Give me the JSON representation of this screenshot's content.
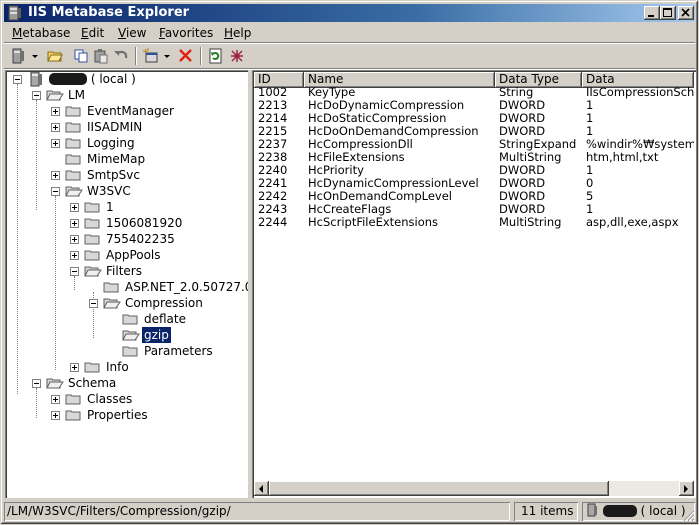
{
  "window": {
    "title": "IIS Metabase Explorer"
  },
  "menu": [
    {
      "label": "Metabase"
    },
    {
      "label": "Edit"
    },
    {
      "label": "View"
    },
    {
      "label": "Favorites"
    },
    {
      "label": "Help"
    }
  ],
  "tree": {
    "root_label": "( local )",
    "nodes": [
      {
        "label": "LM"
      },
      {
        "label": "EventManager"
      },
      {
        "label": "IISADMIN"
      },
      {
        "label": "Logging"
      },
      {
        "label": "MimeMap"
      },
      {
        "label": "SmtpSvc"
      },
      {
        "label": "W3SVC"
      },
      {
        "label": "1"
      },
      {
        "label": "1506081920"
      },
      {
        "label": "755402235"
      },
      {
        "label": "AppPools"
      },
      {
        "label": "Filters"
      },
      {
        "label": "ASP.NET_2.0.50727.0"
      },
      {
        "label": "Compression"
      },
      {
        "label": "deflate"
      },
      {
        "label": "gzip"
      },
      {
        "label": "Parameters"
      },
      {
        "label": "Info"
      },
      {
        "label": "Schema"
      },
      {
        "label": "Classes"
      },
      {
        "label": "Properties"
      }
    ]
  },
  "list": {
    "columns": [
      "ID",
      "Name",
      "Data Type",
      "Data"
    ],
    "rows": [
      {
        "id": "1002",
        "name": "KeyType",
        "type": "String",
        "data": "IIsCompressionSch"
      },
      {
        "id": "2213",
        "name": "HcDoDynamicCompression",
        "type": "DWORD",
        "data": "1"
      },
      {
        "id": "2214",
        "name": "HcDoStaticCompression",
        "type": "DWORD",
        "data": "1"
      },
      {
        "id": "2215",
        "name": "HcDoOnDemandCompression",
        "type": "DWORD",
        "data": "1"
      },
      {
        "id": "2237",
        "name": "HcCompressionDll",
        "type": "StringExpand",
        "data": "%windir%₩system"
      },
      {
        "id": "2238",
        "name": "HcFileExtensions",
        "type": "MultiString",
        "data": "htm,html,txt"
      },
      {
        "id": "2240",
        "name": "HcPriority",
        "type": "DWORD",
        "data": "1"
      },
      {
        "id": "2241",
        "name": "HcDynamicCompressionLevel",
        "type": "DWORD",
        "data": "0"
      },
      {
        "id": "2242",
        "name": "HcOnDemandCompLevel",
        "type": "DWORD",
        "data": "5"
      },
      {
        "id": "2243",
        "name": "HcCreateFlags",
        "type": "DWORD",
        "data": "1"
      },
      {
        "id": "2244",
        "name": "HcScriptFileExtensions",
        "type": "MultiString",
        "data": "asp,dll,exe,aspx"
      }
    ]
  },
  "status": {
    "path": "/LM/W3SVC/Filters/Compression/gzip/",
    "count": "11 items",
    "machine": "( local )"
  },
  "colors": {
    "title_active": "#0a246a",
    "selection": "#0a246a",
    "face": "#d4d0c8"
  },
  "icons": {
    "toolbar": [
      "server-icon",
      "open-folder-icon",
      "copy-icon",
      "paste-icon",
      "undo-icon",
      "new-key-icon",
      "delete-icon",
      "refresh-icon",
      "network-icon"
    ]
  }
}
